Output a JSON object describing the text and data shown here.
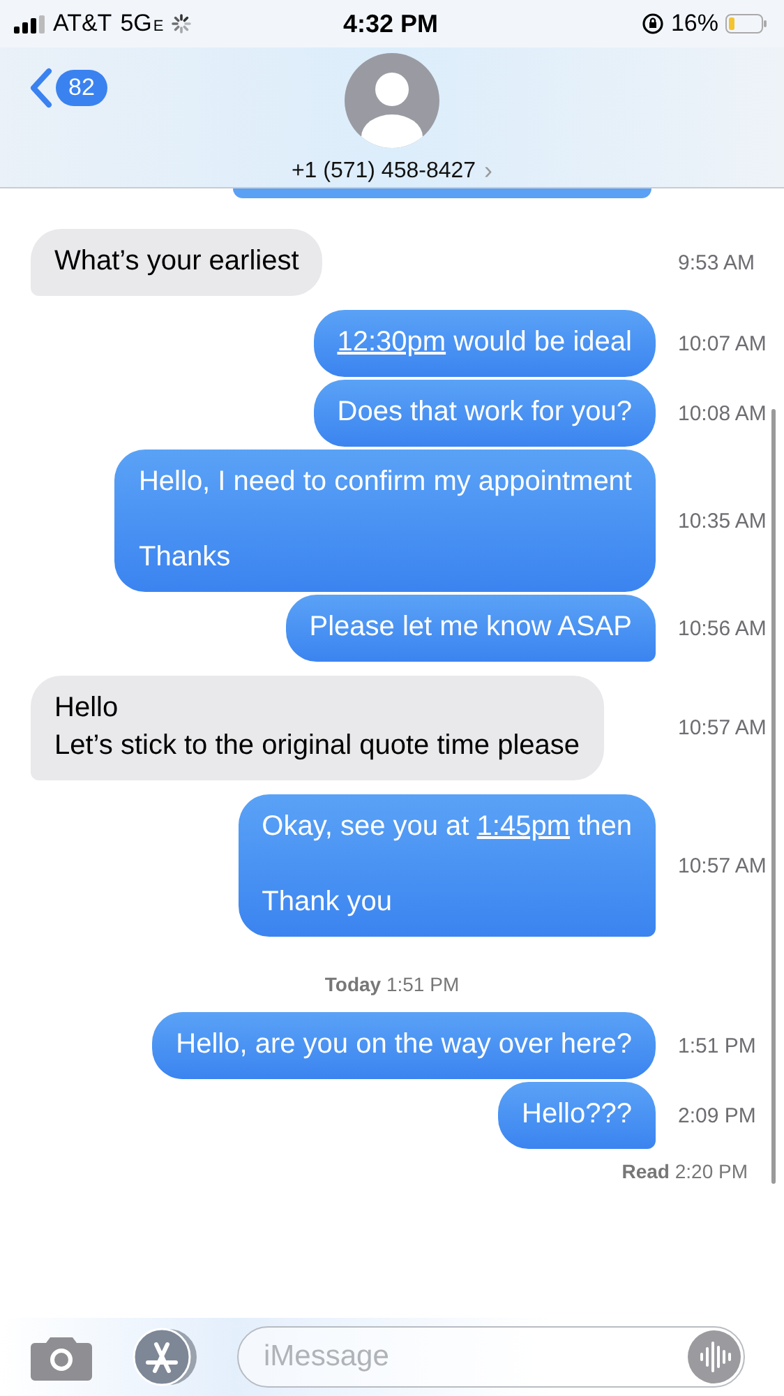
{
  "status_bar": {
    "carrier": "AT&T",
    "network": "5G",
    "network_suffix": "E",
    "time": "4:32 PM",
    "battery_percent": "16%"
  },
  "header": {
    "back_count": "82",
    "contact": "+1 (571) 458-8427",
    "contact_chevron": "›"
  },
  "messages": [
    {
      "kind": "received",
      "parts": [
        {
          "text": "What’s your earliest",
          "link": false
        }
      ],
      "time": "9:53 AM"
    },
    {
      "kind": "sent",
      "parts": [
        {
          "text": "12:30pm",
          "link": true
        },
        {
          "text": " would be ideal",
          "link": false
        }
      ],
      "time": "10:07 AM"
    },
    {
      "kind": "sent",
      "parts": [
        {
          "text": "Does that work for you?",
          "link": false
        }
      ],
      "time": "10:08 AM"
    },
    {
      "kind": "sent",
      "parts": [
        {
          "text": "Hello, I need to confirm my appointment\n\nThanks",
          "link": false
        }
      ],
      "time": "10:35 AM"
    },
    {
      "kind": "sent",
      "parts": [
        {
          "text": "Please let me know ASAP",
          "link": false
        }
      ],
      "time": "10:56 AM"
    },
    {
      "kind": "received",
      "parts": [
        {
          "text": "Hello\nLet’s stick to the original quote time please",
          "link": false
        }
      ],
      "time": "10:57 AM"
    },
    {
      "kind": "sent",
      "parts": [
        {
          "text": "Okay, see you at ",
          "link": false
        },
        {
          "text": "1:45pm",
          "link": true
        },
        {
          "text": " then\n\nThank you",
          "link": false
        }
      ],
      "time": "10:57 AM"
    },
    {
      "kind": "separator",
      "text": "**Today** 1:51 PM"
    },
    {
      "kind": "sent",
      "parts": [
        {
          "text": "Hello, are you on the way over here?",
          "link": false
        }
      ],
      "time": "1:51 PM"
    },
    {
      "kind": "sent",
      "parts": [
        {
          "text": "Hello???",
          "link": false
        }
      ],
      "time": "2:09 PM"
    }
  ],
  "read_receipt": "**Read** 2:20 PM",
  "compose": {
    "placeholder": "iMessage"
  }
}
